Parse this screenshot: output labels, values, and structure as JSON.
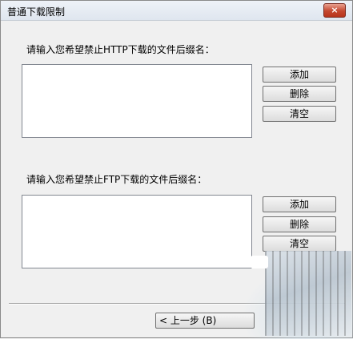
{
  "window": {
    "title": "普通下载限制",
    "close_glyph": "×"
  },
  "http_section": {
    "label": "请输入您希望禁止HTTP下载的文件后缀名：",
    "add_label": "添加",
    "delete_label": "删除",
    "clear_label": "清空"
  },
  "ftp_section": {
    "label": "请输入您希望禁止FTP下载的文件后缀名：",
    "add_label": "添加",
    "delete_label": "删除",
    "clear_label": "清空"
  },
  "footer": {
    "back_label": "< 上一步 (B)"
  }
}
